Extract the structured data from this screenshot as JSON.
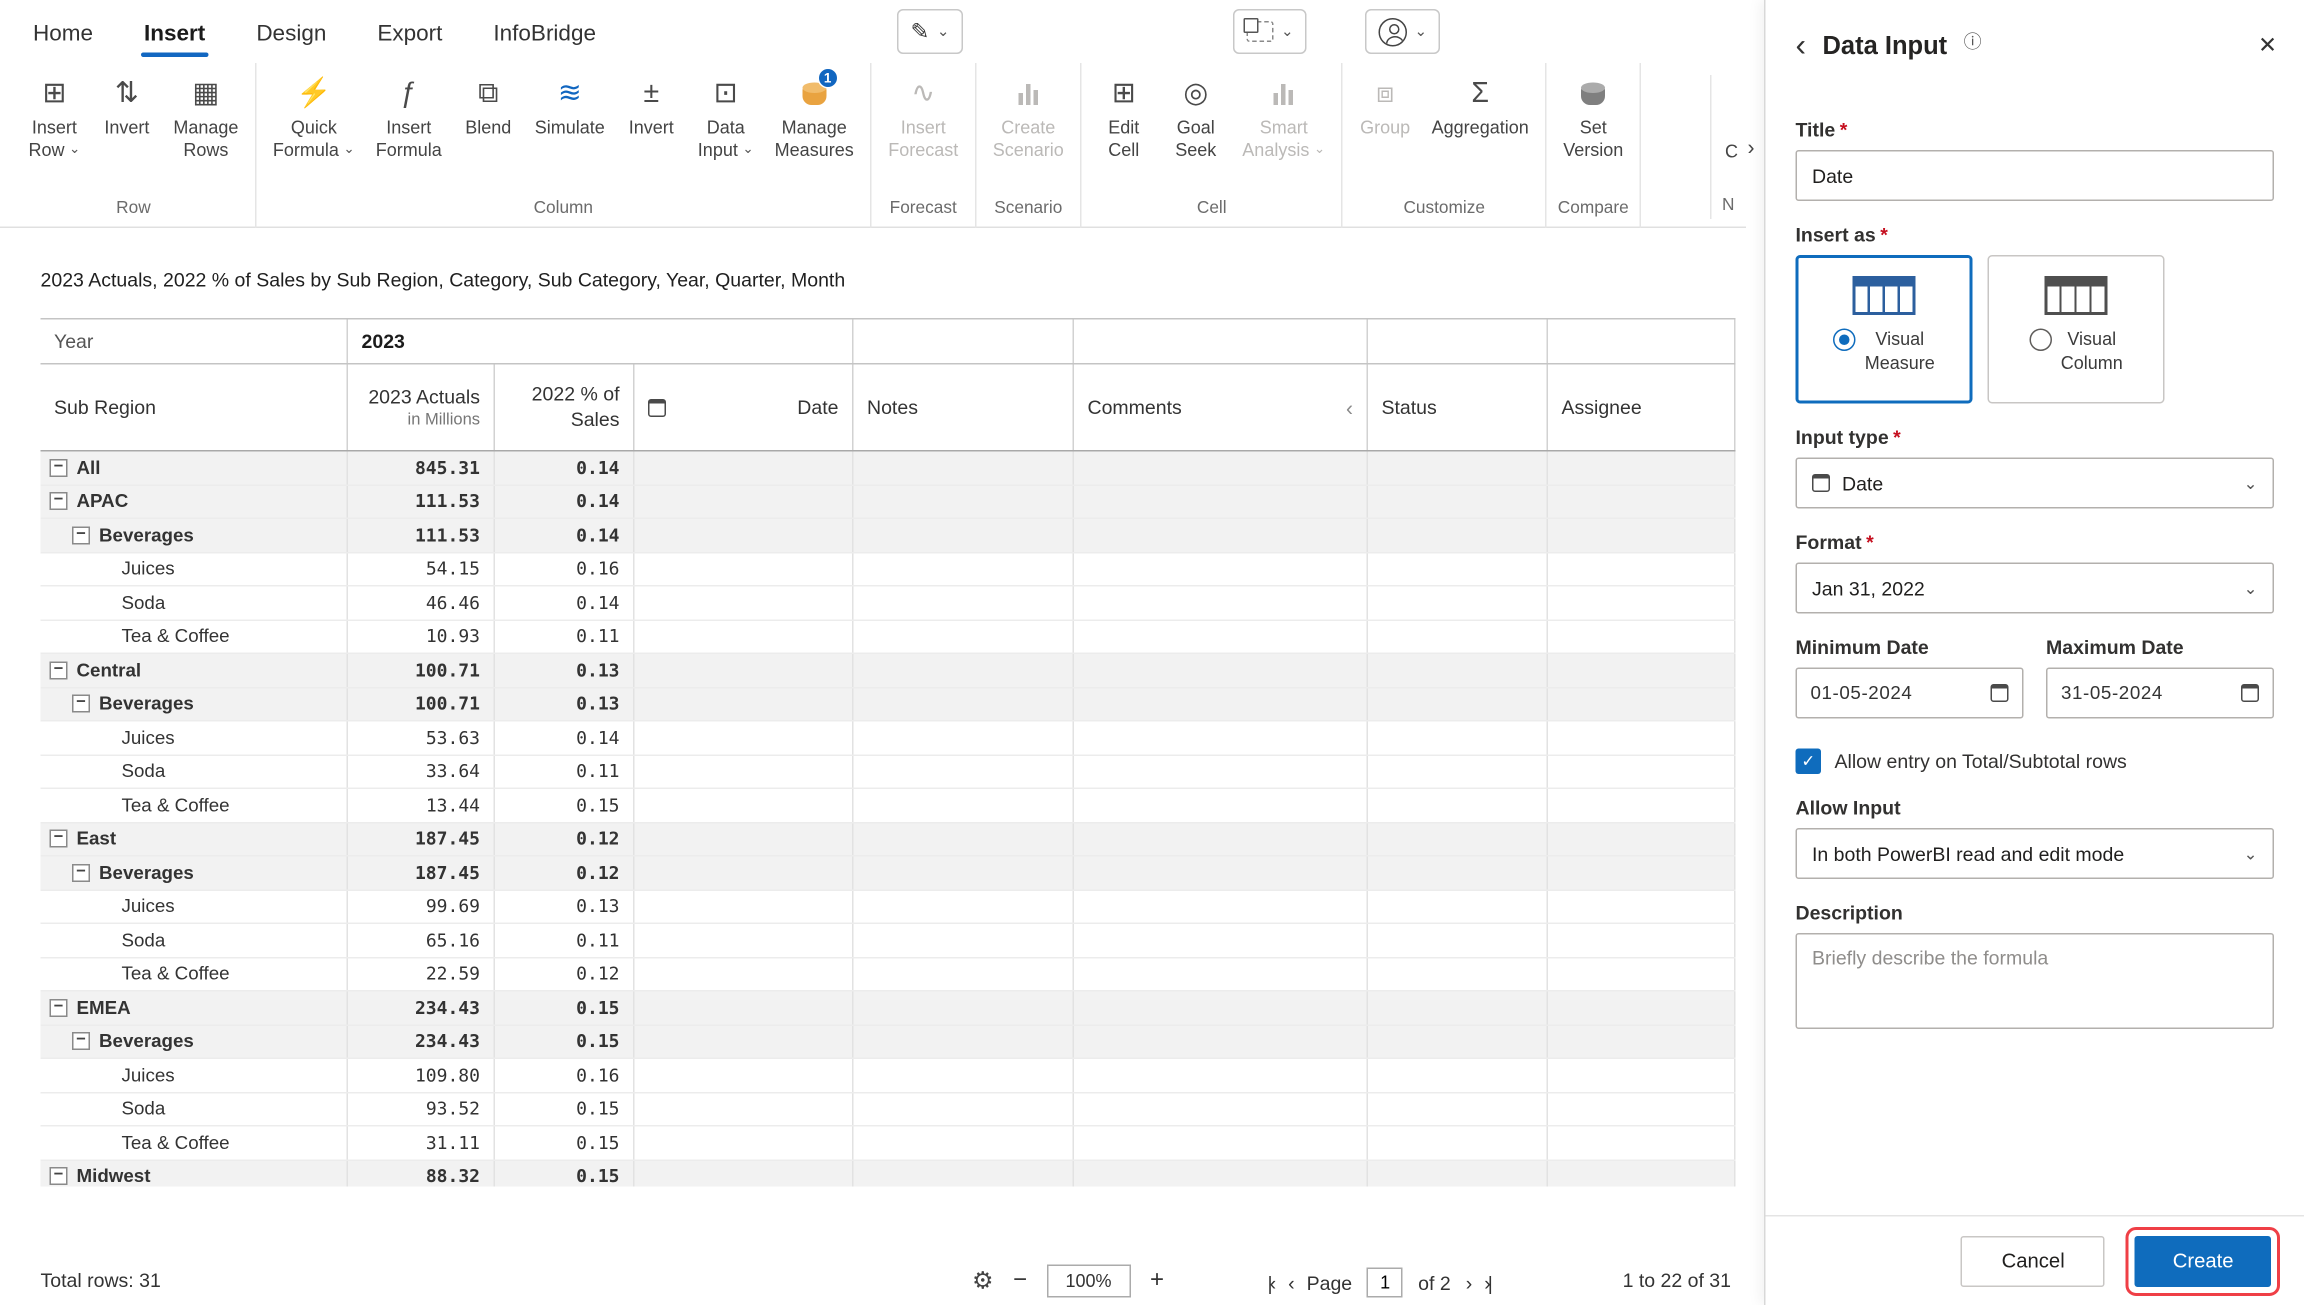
{
  "ribbon": {
    "tabs": [
      {
        "label": "Home",
        "active": false
      },
      {
        "label": "Insert",
        "active": true
      },
      {
        "label": "Design",
        "active": false
      },
      {
        "label": "Export",
        "active": false
      },
      {
        "label": "InfoBridge",
        "active": false
      }
    ],
    "groups": [
      {
        "label": "Row",
        "buttons": [
          {
            "label": "Insert Row",
            "lines": [
              "Insert",
              "Row"
            ],
            "icon": "insert-row",
            "dropdown": true
          },
          {
            "label": "Invert",
            "lines": [
              "Invert"
            ],
            "icon": "invert-rows"
          },
          {
            "label": "Manage Rows",
            "lines": [
              "Manage",
              "Rows"
            ],
            "icon": "manage-rows"
          }
        ]
      },
      {
        "label": "Column",
        "buttons": [
          {
            "label": "Quick Formula",
            "lines": [
              "Quick",
              "Formula"
            ],
            "icon": "quick-formula",
            "dropdown": true,
            "accent": true
          },
          {
            "label": "Insert Formula",
            "lines": [
              "Insert",
              "Formula"
            ],
            "icon": "insert-formula"
          },
          {
            "label": "Blend",
            "lines": [
              "Blend"
            ],
            "icon": "blend"
          },
          {
            "label": "Simulate",
            "lines": [
              "Simulate"
            ],
            "icon": "simulate",
            "accent": true
          },
          {
            "label": "Invert",
            "lines": [
              "Invert"
            ],
            "icon": "invert-columns"
          },
          {
            "label": "Data Input",
            "lines": [
              "Data",
              "Input"
            ],
            "icon": "data-input",
            "dropdown": true
          },
          {
            "label": "Manage Measures",
            "lines": [
              "Manage",
              "Measures"
            ],
            "icon": "manage-measures",
            "badge": "1"
          }
        ]
      },
      {
        "label": "Forecast",
        "buttons": [
          {
            "label": "Insert Forecast",
            "lines": [
              "Insert",
              "Forecast"
            ],
            "icon": "insert-forecast",
            "disabled": true
          }
        ]
      },
      {
        "label": "Scenario",
        "buttons": [
          {
            "label": "Create Scenario",
            "lines": [
              "Create",
              "Scenario"
            ],
            "icon": "create-scenario",
            "disabled": true
          }
        ]
      },
      {
        "label": "Cell",
        "buttons": [
          {
            "label": "Edit Cell",
            "lines": [
              "Edit",
              "Cell"
            ],
            "icon": "edit-cell"
          },
          {
            "label": "Goal Seek",
            "lines": [
              "Goal",
              "Seek"
            ],
            "icon": "goal-seek"
          },
          {
            "label": "Smart Analysis",
            "lines": [
              "Smart",
              "Analysis"
            ],
            "icon": "smart-analysis",
            "dropdown": true,
            "disabled": true
          }
        ]
      },
      {
        "label": "Customize",
        "buttons": [
          {
            "label": "Group",
            "lines": [
              "Group"
            ],
            "icon": "group",
            "disabled": true
          },
          {
            "label": "Aggregation",
            "lines": [
              "Aggregation"
            ],
            "icon": "aggregation"
          }
        ]
      },
      {
        "label": "Compare",
        "buttons": [
          {
            "label": "Set Version",
            "lines": [
              "Set",
              "Version"
            ],
            "icon": "set-version"
          }
        ]
      }
    ],
    "overflow": {
      "button_line": "C",
      "group_label": "N"
    }
  },
  "report": {
    "title": "2023 Actuals, 2022 % of Sales by Sub Region, Category, Sub Category, Year, Quarter, Month"
  },
  "table": {
    "year_header": {
      "label": "Year",
      "year": "2023"
    },
    "columns": [
      {
        "key": "subregion",
        "label": "Sub Region"
      },
      {
        "key": "actuals",
        "label": "2023 Actuals",
        "sub": "in Millions"
      },
      {
        "key": "sales",
        "label": "2022 % of Sales"
      },
      {
        "key": "date",
        "label": "Date",
        "icon": "calendar-icon"
      },
      {
        "key": "notes",
        "label": "Notes"
      },
      {
        "key": "comments",
        "label": "Comments"
      },
      {
        "key": "status",
        "label": "Status"
      },
      {
        "key": "assignee",
        "label": "Assignee"
      }
    ],
    "rows": [
      {
        "label": "All",
        "level": 0,
        "bold": true,
        "expand": true,
        "actuals": "845.31",
        "sales": "0.14"
      },
      {
        "label": "APAC",
        "level": 0,
        "bold": true,
        "expand": true,
        "actuals": "111.53",
        "sales": "0.14"
      },
      {
        "label": "Beverages",
        "level": 1,
        "bold": true,
        "expand": true,
        "actuals": "111.53",
        "sales": "0.14"
      },
      {
        "label": "Juices",
        "level": 2,
        "bold": false,
        "expand": false,
        "actuals": "54.15",
        "sales": "0.16"
      },
      {
        "label": "Soda",
        "level": 2,
        "bold": false,
        "expand": false,
        "actuals": "46.46",
        "sales": "0.14"
      },
      {
        "label": "Tea & Coffee",
        "level": 2,
        "bold": false,
        "expand": false,
        "actuals": "10.93",
        "sales": "0.11"
      },
      {
        "label": "Central",
        "level": 0,
        "bold": true,
        "expand": true,
        "actuals": "100.71",
        "sales": "0.13"
      },
      {
        "label": "Beverages",
        "level": 1,
        "bold": true,
        "expand": true,
        "actuals": "100.71",
        "sales": "0.13"
      },
      {
        "label": "Juices",
        "level": 2,
        "bold": false,
        "expand": false,
        "actuals": "53.63",
        "sales": "0.14"
      },
      {
        "label": "Soda",
        "level": 2,
        "bold": false,
        "expand": false,
        "actuals": "33.64",
        "sales": "0.11"
      },
      {
        "label": "Tea & Coffee",
        "level": 2,
        "bold": false,
        "expand": false,
        "actuals": "13.44",
        "sales": "0.15"
      },
      {
        "label": "East",
        "level": 0,
        "bold": true,
        "expand": true,
        "actuals": "187.45",
        "sales": "0.12"
      },
      {
        "label": "Beverages",
        "level": 1,
        "bold": true,
        "expand": true,
        "actuals": "187.45",
        "sales": "0.12"
      },
      {
        "label": "Juices",
        "level": 2,
        "bold": false,
        "expand": false,
        "actuals": "99.69",
        "sales": "0.13"
      },
      {
        "label": "Soda",
        "level": 2,
        "bold": false,
        "expand": false,
        "actuals": "65.16",
        "sales": "0.11"
      },
      {
        "label": "Tea & Coffee",
        "level": 2,
        "bold": false,
        "expand": false,
        "actuals": "22.59",
        "sales": "0.12"
      },
      {
        "label": "EMEA",
        "level": 0,
        "bold": true,
        "expand": true,
        "actuals": "234.43",
        "sales": "0.15"
      },
      {
        "label": "Beverages",
        "level": 1,
        "bold": true,
        "expand": true,
        "actuals": "234.43",
        "sales": "0.15"
      },
      {
        "label": "Juices",
        "level": 2,
        "bold": false,
        "expand": false,
        "actuals": "109.80",
        "sales": "0.16"
      },
      {
        "label": "Soda",
        "level": 2,
        "bold": false,
        "expand": false,
        "actuals": "93.52",
        "sales": "0.15"
      },
      {
        "label": "Tea & Coffee",
        "level": 2,
        "bold": false,
        "expand": false,
        "actuals": "31.11",
        "sales": "0.15"
      },
      {
        "label": "Midwest",
        "level": 0,
        "bold": true,
        "expand": true,
        "actuals": "88.32",
        "sales": "0.15"
      }
    ]
  },
  "statusbar": {
    "total_rows": "Total rows: 31",
    "zoom_value": "100%",
    "page_label": "Page",
    "page_value": "1",
    "of_label": "of 2",
    "range": "1 to 22 of 31"
  },
  "panel": {
    "title": "Data Input",
    "title_field": {
      "label": "Title",
      "value": "Date"
    },
    "insert_as": {
      "label": "Insert as",
      "options": [
        {
          "line1": "Visual",
          "line2": "Measure",
          "selected": true
        },
        {
          "line1": "Visual",
          "line2": "Column",
          "selected": false
        }
      ]
    },
    "input_type": {
      "label": "Input type",
      "value": "Date"
    },
    "format": {
      "label": "Format",
      "value": "Jan 31, 2022"
    },
    "min_date": {
      "label": "Minimum Date",
      "value": "01-05-2024"
    },
    "max_date": {
      "label": "Maximum Date",
      "value": "31-05-2024"
    },
    "allow_total": {
      "label": "Allow entry on Total/Subtotal rows",
      "checked": true
    },
    "allow_input": {
      "label": "Allow Input",
      "value": "In both PowerBI read and edit mode"
    },
    "description": {
      "label": "Description",
      "placeholder": "Briefly describe the formula"
    },
    "buttons": {
      "cancel": "Cancel",
      "create": "Create"
    }
  },
  "colors": {
    "accent_blue": "#0f6cbd",
    "ribbon_icon_blue": "#1166c0",
    "badge_blue": "#1166c0",
    "measure_db_orange": "#e9a340",
    "annotation_red": "#ef3f46",
    "required_red": "#c50f1f"
  }
}
